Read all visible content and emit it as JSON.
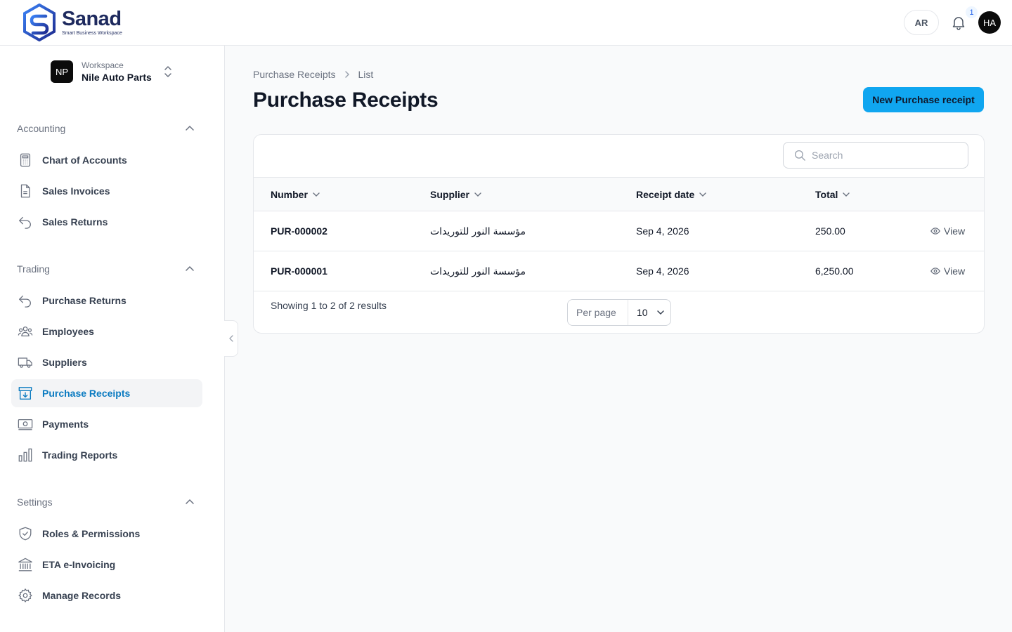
{
  "brand": {
    "name": "Sanad",
    "tagline": "Smart Business Workspace"
  },
  "header": {
    "language_button": "AR",
    "notification_count": "1",
    "user_initials": "HA"
  },
  "workspace": {
    "initials": "NP",
    "label": "Workspace",
    "name": "Nile Auto Parts"
  },
  "sidebar": {
    "sections": [
      {
        "title": "Accounting",
        "items": [
          {
            "label": "Chart of Accounts",
            "icon": "calculator-icon"
          },
          {
            "label": "Sales Invoices",
            "icon": "document-icon"
          },
          {
            "label": "Sales Returns",
            "icon": "return-arrow-icon"
          }
        ]
      },
      {
        "title": "Trading",
        "items": [
          {
            "label": "Purchase Returns",
            "icon": "return-arrow-icon"
          },
          {
            "label": "Employees",
            "icon": "users-icon"
          },
          {
            "label": "Suppliers",
            "icon": "truck-icon"
          },
          {
            "label": "Purchase Receipts",
            "icon": "archive-down-icon",
            "active": true
          },
          {
            "label": "Payments",
            "icon": "banknote-icon"
          },
          {
            "label": "Trading Reports",
            "icon": "bar-chart-icon"
          }
        ]
      },
      {
        "title": "Settings",
        "items": [
          {
            "label": "Roles & Permissions",
            "icon": "shield-check-icon"
          },
          {
            "label": "ETA e-Invoicing",
            "icon": "bank-building-icon"
          },
          {
            "label": "Manage Records",
            "icon": "gear-icon"
          }
        ]
      }
    ]
  },
  "breadcrumb": [
    "Purchase Receipts",
    "List"
  ],
  "page": {
    "title": "Purchase Receipts",
    "new_button": "New Purchase receipt"
  },
  "search": {
    "placeholder": "Search"
  },
  "table": {
    "columns": [
      "Number",
      "Supplier",
      "Receipt date",
      "Total"
    ],
    "rows": [
      {
        "number": "PUR-000002",
        "supplier": "مؤسسة النور للتوريدات",
        "date": "Sep 4, 2026",
        "total": "250.00",
        "action": "View"
      },
      {
        "number": "PUR-000001",
        "supplier": "مؤسسة النور للتوريدات",
        "date": "Sep 4, 2026",
        "total": "6,250.00",
        "action": "View"
      }
    ]
  },
  "pagination": {
    "summary": "Showing 1 to 2 of 2 results",
    "per_page_label": "Per page",
    "per_page_value": "10"
  },
  "colors": {
    "accent": "#10a6f0",
    "active_text": "#0b7bc1",
    "brand_navy": "#1e2a5e"
  }
}
